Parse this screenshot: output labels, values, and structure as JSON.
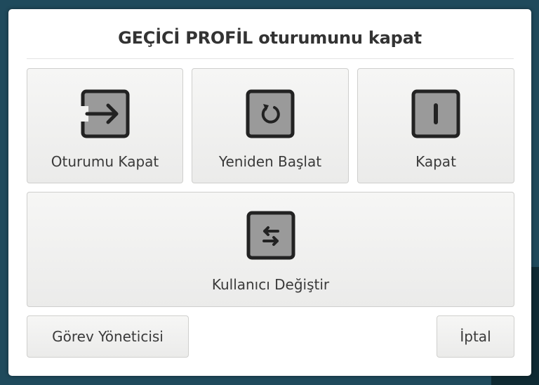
{
  "dialog": {
    "title": "GEÇİCİ PROFİL oturumunu kapat"
  },
  "actions": {
    "logout": {
      "label": "Oturumu Kapat",
      "icon": "logout-arrow-icon"
    },
    "restart": {
      "label": "Yeniden Başlat",
      "icon": "restart-icon"
    },
    "shutdown": {
      "label": "Kapat",
      "icon": "power-icon"
    },
    "switch_user": {
      "label": "Kullanıcı Değiştir",
      "icon": "switch-user-icon"
    }
  },
  "footer": {
    "task_manager_label": "Görev Yöneticisi",
    "cancel_label": "İptal"
  },
  "colors": {
    "desktop": "#1f4a5c",
    "dialog_bg": "#ffffff",
    "button_bg": "#f2f2f1",
    "icon_fill": "#9a9a9a",
    "icon_stroke": "#222222"
  }
}
